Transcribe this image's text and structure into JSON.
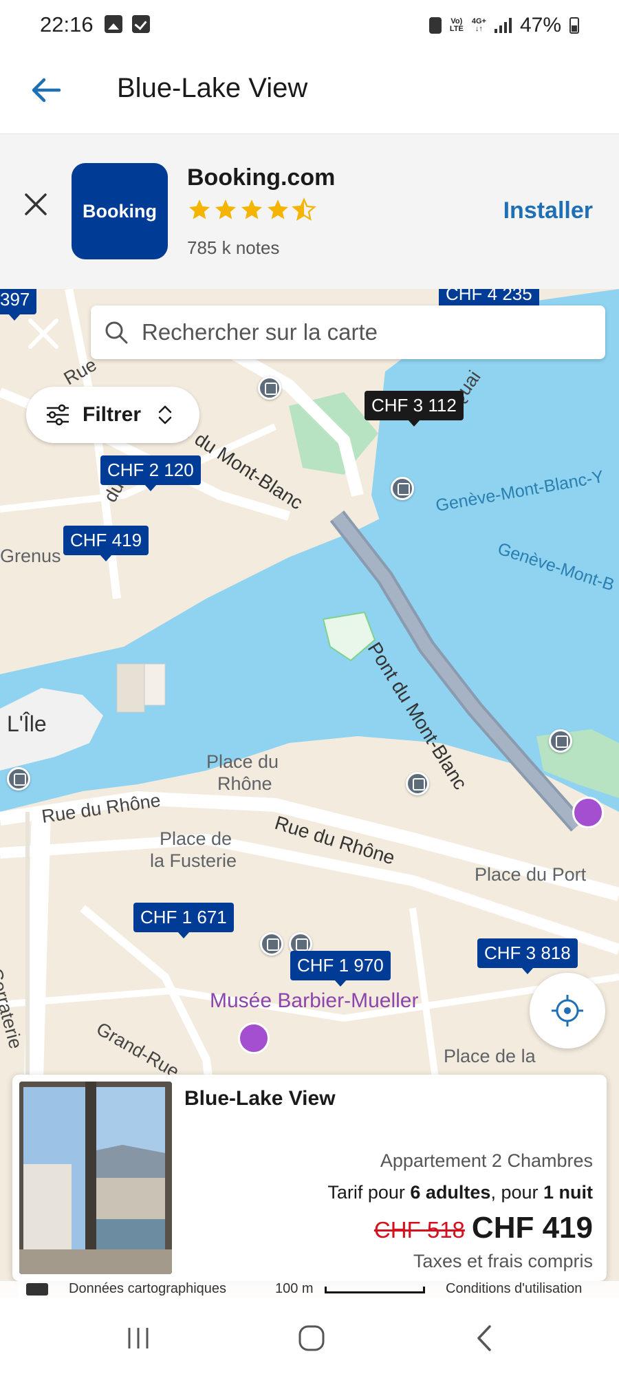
{
  "status_bar": {
    "time": "22:16",
    "network_top": "Vo)",
    "network_bottom": "LTE",
    "data_top": "4G+",
    "data_bottom": "↓↑",
    "battery": "47%"
  },
  "app_bar": {
    "title": "Blue-Lake View",
    "back_icon": "arrow-left-icon"
  },
  "app_banner": {
    "app_icon_label": "Booking",
    "app_name": "Booking.com",
    "rating_stars": 4.5,
    "reviews": "785 k notes",
    "install_label": "Installer",
    "accent_color": "#1f6fb5",
    "icon_color": "#003b95"
  },
  "map": {
    "search_placeholder": "Rechercher sur la carte",
    "filter_label": "Filtrer",
    "labels": {
      "rue_mont_blanc": "Rue du Mont-Blanc",
      "rue_top": "Rue",
      "rue_ce": "du Ce",
      "grenus": "Grenus",
      "pont_mont_blanc": "Pont du Mont-Blanc",
      "geneve_1": "Genève-Mont-Blanc-Y",
      "geneve_2": "Genève-Mont-B",
      "quai": "Quai",
      "l_ile": "L'Île",
      "place_rhone_1": "Place du",
      "place_rhone_2": "Rhône",
      "rue_rhone_left": "Rue du Rhône",
      "rue_rhone_center": "Rue du Rhône",
      "place_fusterie_1": "Place de",
      "place_fusterie_2": "la Fusterie",
      "place_port": "Place du Port",
      "musee": "Musée Barbier-Mueller",
      "grand_rue": "Grand-Rue",
      "place_madeleine": "Place de la",
      "corraterie": "de la Corraterie"
    },
    "prices": {
      "p_top_left": "397",
      "p_top_right": "CHF 4 235",
      "p_3112": "CHF 3 112",
      "p_2120": "CHF 2 120",
      "p_419": "CHF 419",
      "p_1671": "CHF 1 671",
      "p_1970": "CHF 1 970",
      "p_3818": "CHF 3 818"
    },
    "footer": {
      "data": "Données cartographiques",
      "scale": "100 m",
      "terms": "Conditions d'utilisation"
    },
    "water_color": "#8fd3f0",
    "pin_color": "#003b95"
  },
  "property_card": {
    "title": "Blue-Lake View",
    "type": "Appartement 2 Chambres",
    "rate_prefix": "Tarif pour ",
    "rate_guests": "6 adultes",
    "rate_mid": ", pour ",
    "rate_nights": "1 nuit",
    "old_price": "CHF 518",
    "new_price": "CHF 419",
    "taxes": "Taxes et frais compris",
    "old_price_color": "#d4111e"
  }
}
